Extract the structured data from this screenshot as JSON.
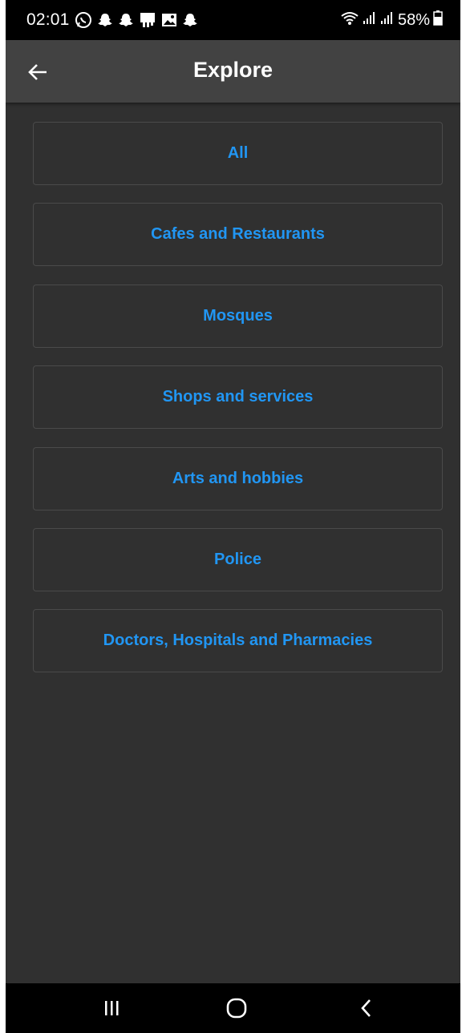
{
  "status_bar": {
    "time": "02:01",
    "battery": "58%",
    "icons": [
      "whatsapp-icon",
      "snapchat-icon",
      "snapchat-icon",
      "notification-icon",
      "gallery-icon",
      "snapchat-icon",
      "wifi-icon",
      "signal-icon",
      "signal-icon",
      "battery-icon"
    ]
  },
  "app_bar": {
    "title": "Explore",
    "back_icon": "arrow-left-icon"
  },
  "categories": [
    {
      "label": "All"
    },
    {
      "label": "Cafes and Restaurants"
    },
    {
      "label": "Mosques"
    },
    {
      "label": "Shops and services"
    },
    {
      "label": "Arts and hobbies"
    },
    {
      "label": "Police"
    },
    {
      "label": "Doctors, Hospitals and Pharmacies"
    }
  ],
  "nav_bar": {
    "buttons": [
      "recent-apps-icon",
      "home-icon",
      "back-icon"
    ]
  },
  "colors": {
    "background": "#303030",
    "app_bar": "#424242",
    "accent": "#2196f3",
    "border": "#4a4a4a"
  }
}
